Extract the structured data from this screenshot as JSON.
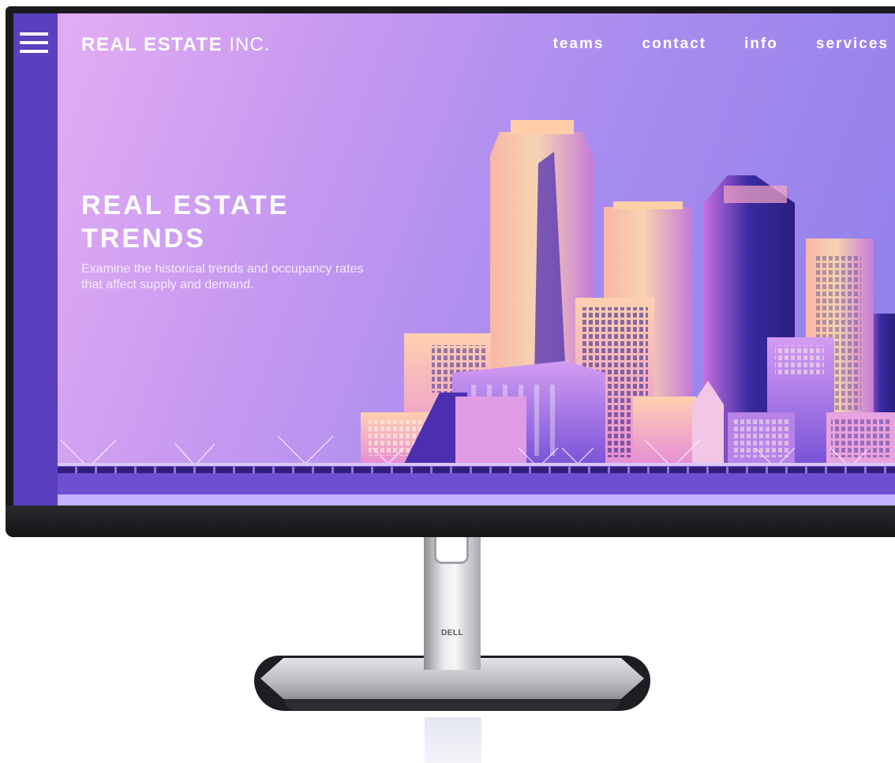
{
  "header": {
    "brand_bold": "REAL ESTATE",
    "brand_light": "INC.",
    "nav": [
      "teams",
      "contact",
      "info",
      "services"
    ]
  },
  "hero": {
    "title_line1": "REAL ESTATE",
    "title_line2": "TRENDS",
    "subtitle": "Examine the historical trends and occupancy rates that affect supply and demand."
  },
  "monitor": {
    "stand_logo": "DELL"
  },
  "colors": {
    "rail": "#5a3fbf",
    "sky_start": "#e7b0f4",
    "sky_end": "#8f7fe9",
    "ground": "#6d4fd0"
  },
  "icons": [
    "hamburger-menu-icon"
  ]
}
